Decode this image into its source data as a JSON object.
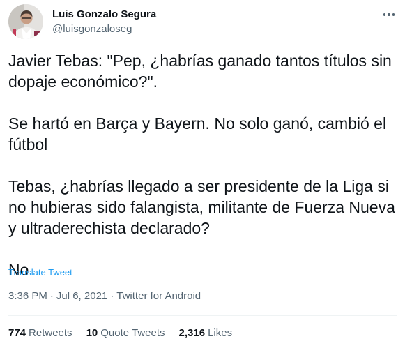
{
  "author": {
    "name": "Luis Gonzalo Segura",
    "handle": "@luisgonzaloseg"
  },
  "tweet": {
    "paragraphs": [
      "Javier Tebas: \"Pep, ¿habrías ganado tantos títulos sin dopaje económico?\".",
      "Se hartó en Barça y Bayern. No solo ganó, cambió el fútbol",
      "Tebas, ¿habrías llegado a ser presidente de la Liga si no hubieras sido falangista, militante de Fuerza Nueva y ultraderechista declarado?",
      "No"
    ],
    "translate_label": "Translate Tweet",
    "time": "3:36 PM",
    "date": "Jul 6, 2021",
    "source": "Twitter for Android",
    "separator": "·"
  },
  "stats": {
    "retweets_count": "774",
    "retweets_label": "Retweets",
    "quotes_count": "10",
    "quotes_label": "Quote Tweets",
    "likes_count": "2,316",
    "likes_label": "Likes"
  },
  "icons": {
    "more": "more-dots-icon"
  },
  "colors": {
    "text": "#0f1419",
    "muted": "#536471",
    "link": "#1d9bf0",
    "divider": "#eff3f4"
  }
}
